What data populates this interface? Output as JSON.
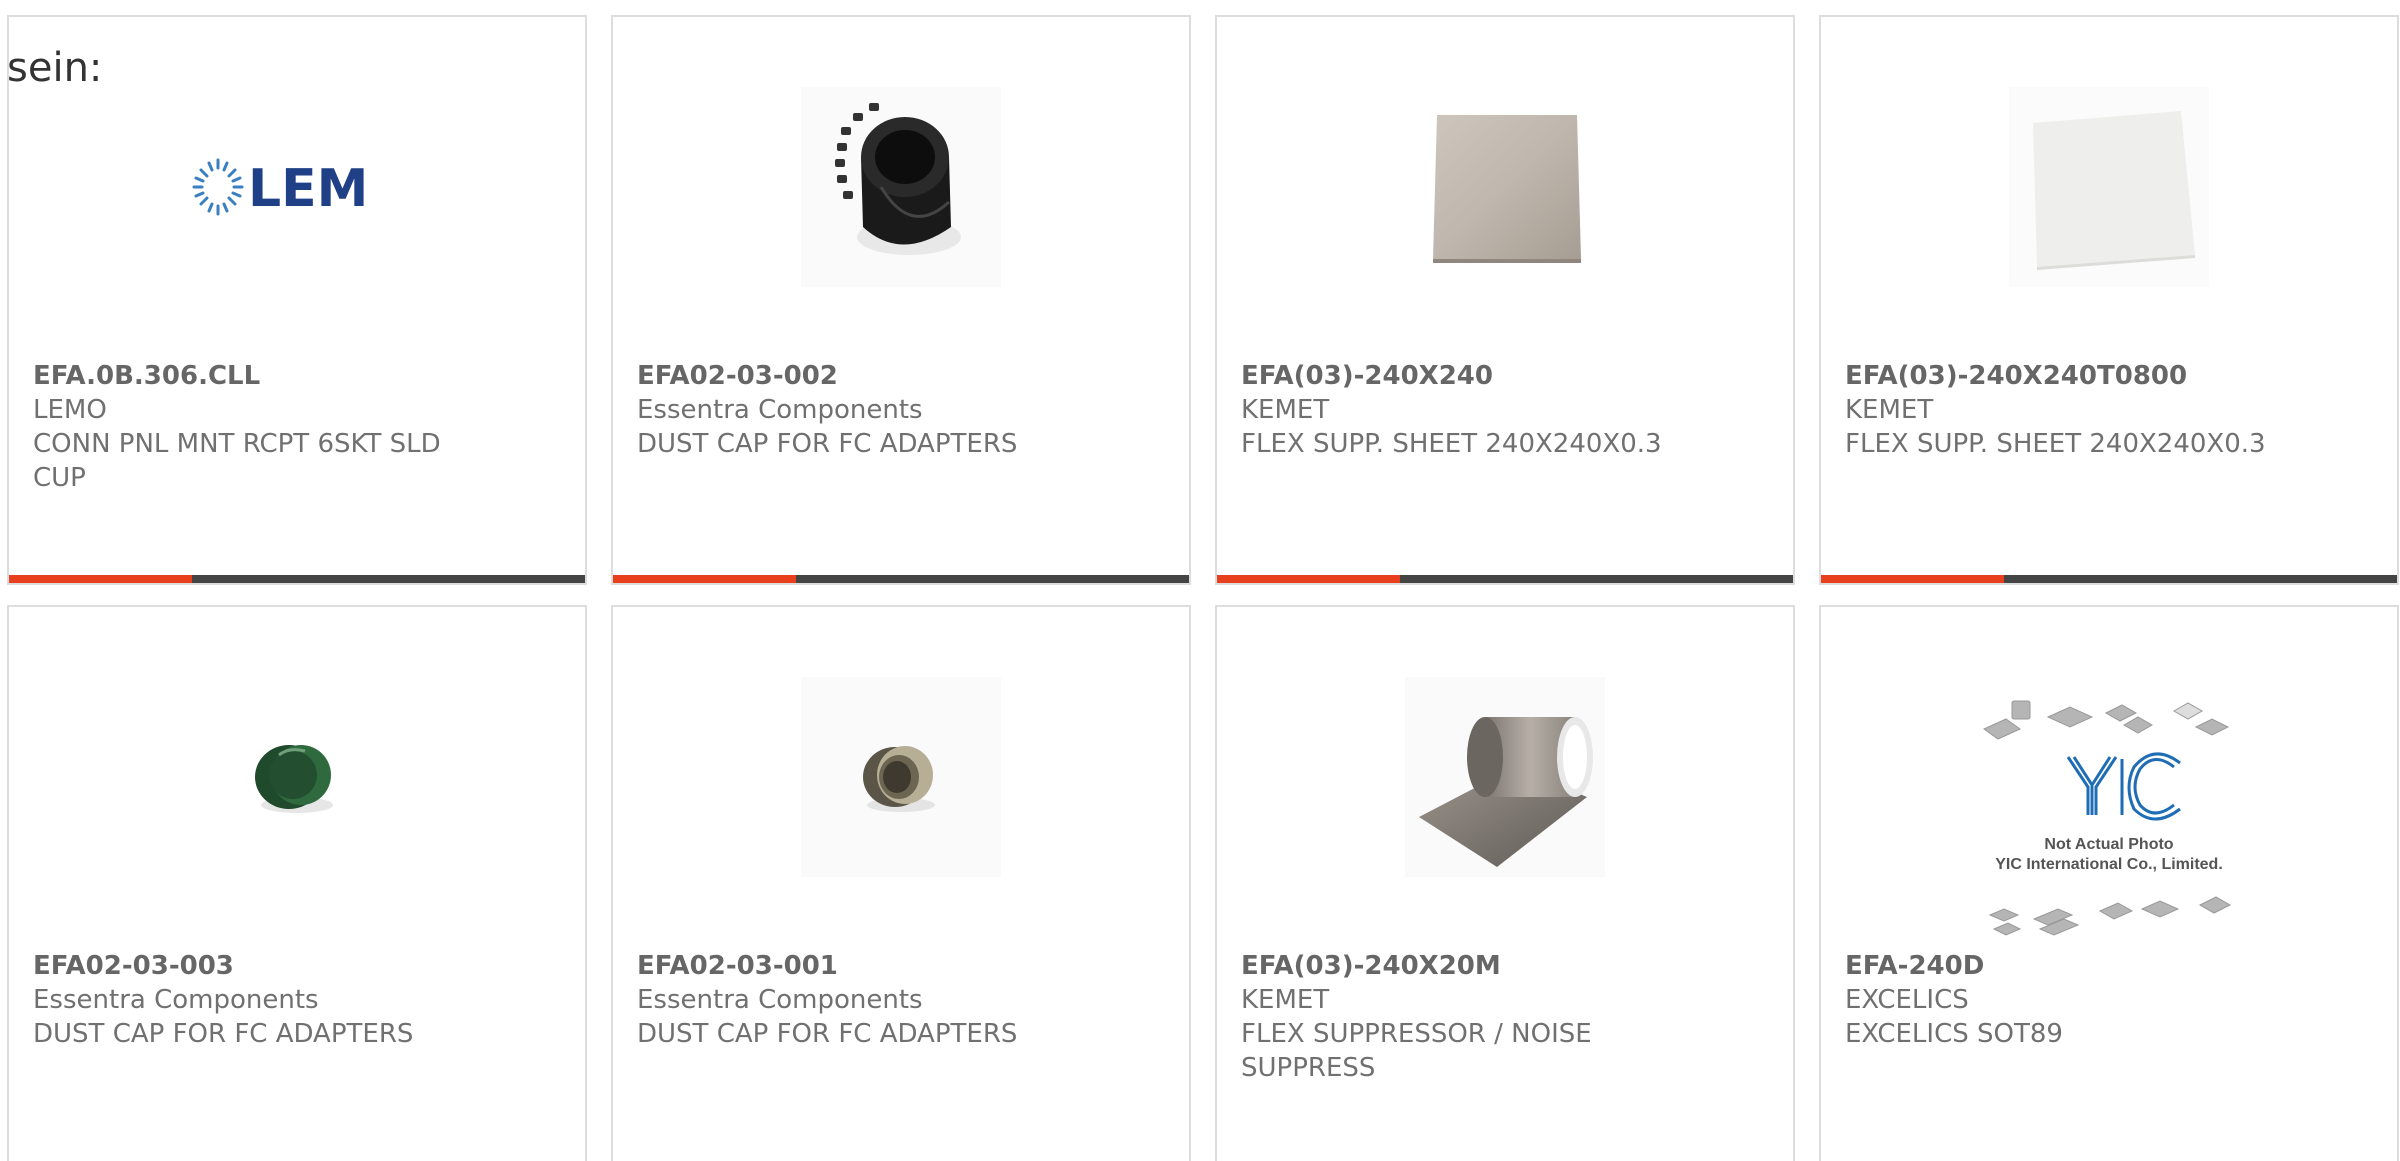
{
  "stray_text": "sein:",
  "colors": {
    "accent": "#e8401c",
    "bar": "#444444",
    "border": "#dddddd",
    "text": "#707070"
  },
  "products": [
    {
      "part_number": "EFA.0B.306.CLL",
      "manufacturer": "LEMO",
      "description": "CONN PNL MNT RCPT 6SKT SLD CUP",
      "image": "lem-logo",
      "logo_text": "LEM"
    },
    {
      "part_number": "EFA02-03-002",
      "manufacturer": "Essentra Components",
      "description": "DUST CAP FOR FC ADAPTERS",
      "image": "black-knurled-cap"
    },
    {
      "part_number": "EFA(03)-240X240",
      "manufacturer": "KEMET",
      "description": "FLEX SUPP. SHEET 240X240X0.3",
      "image": "gray-sheet"
    },
    {
      "part_number": "EFA(03)-240X240T0800",
      "manufacturer": "KEMET",
      "description": "FLEX SUPP. SHEET 240X240X0.3",
      "image": "white-sheet"
    },
    {
      "part_number": "EFA02-03-003",
      "manufacturer": "Essentra Components",
      "description": "DUST CAP FOR FC ADAPTERS",
      "image": "green-cap"
    },
    {
      "part_number": "EFA02-03-001",
      "manufacturer": "Essentra Components",
      "description": "DUST CAP FOR FC ADAPTERS",
      "image": "olive-cap"
    },
    {
      "part_number": "EFA(03)-240X20M",
      "manufacturer": "KEMET",
      "description": "FLEX SUPPRESSOR / NOISE SUPPRESS",
      "image": "metal-roll"
    },
    {
      "part_number": "EFA-240D",
      "manufacturer": "EXCELICS",
      "description": "EXCELICS SOT89",
      "image": "yic-placeholder",
      "placeholder_lines": [
        "Not Actual Photo",
        "YIC International Co., Limited."
      ]
    }
  ]
}
